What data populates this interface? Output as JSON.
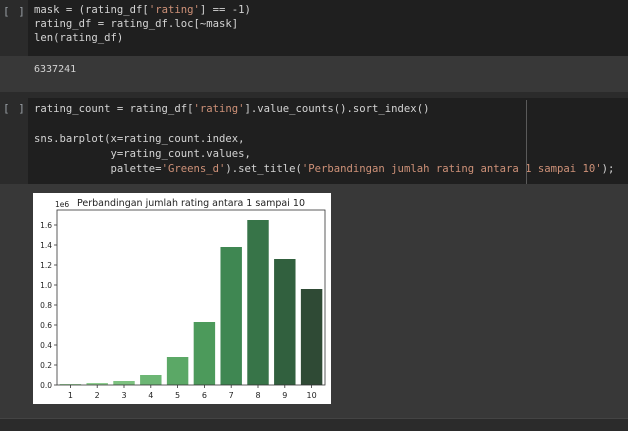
{
  "cell1": {
    "run_label": "[ ]",
    "code": [
      "mask = (rating_df['rating'] == -1)",
      "rating_df = rating_df.loc[~mask]",
      "len(rating_df)"
    ],
    "output": "6337241"
  },
  "cell2": {
    "run_label": "[ ]",
    "code": [
      "rating_count = rating_df['rating'].value_counts().sort_index()",
      "",
      "sns.barplot(x=rating_count.index,",
      "            y=rating_count.values,",
      "            palette='Greens_d').set_title('Perbandingan jumlah rating antara 1 sampai 10');"
    ]
  },
  "chart_data": {
    "type": "bar",
    "title": "Perbandingan jumlah rating antara 1 sampai 10",
    "xlabel": "",
    "ylabel": "",
    "offset_label": "1e6",
    "categories": [
      "1",
      "2",
      "3",
      "4",
      "5",
      "6",
      "7",
      "8",
      "9",
      "10"
    ],
    "values": [
      0.01,
      0.02,
      0.04,
      0.1,
      0.28,
      0.63,
      1.38,
      1.65,
      1.26,
      0.96
    ],
    "ylim": [
      0,
      1.75
    ],
    "yticks": [
      "0.0",
      "0.2",
      "0.4",
      "0.6",
      "0.8",
      "1.0",
      "1.2",
      "1.4",
      "1.6"
    ],
    "colors": [
      "#9bd49b",
      "#8fce90",
      "#7dc280",
      "#6cb674",
      "#5ba866",
      "#4c9a5b",
      "#3f8752",
      "#377448",
      "#31603e",
      "#2f4a35"
    ],
    "grid": false
  }
}
